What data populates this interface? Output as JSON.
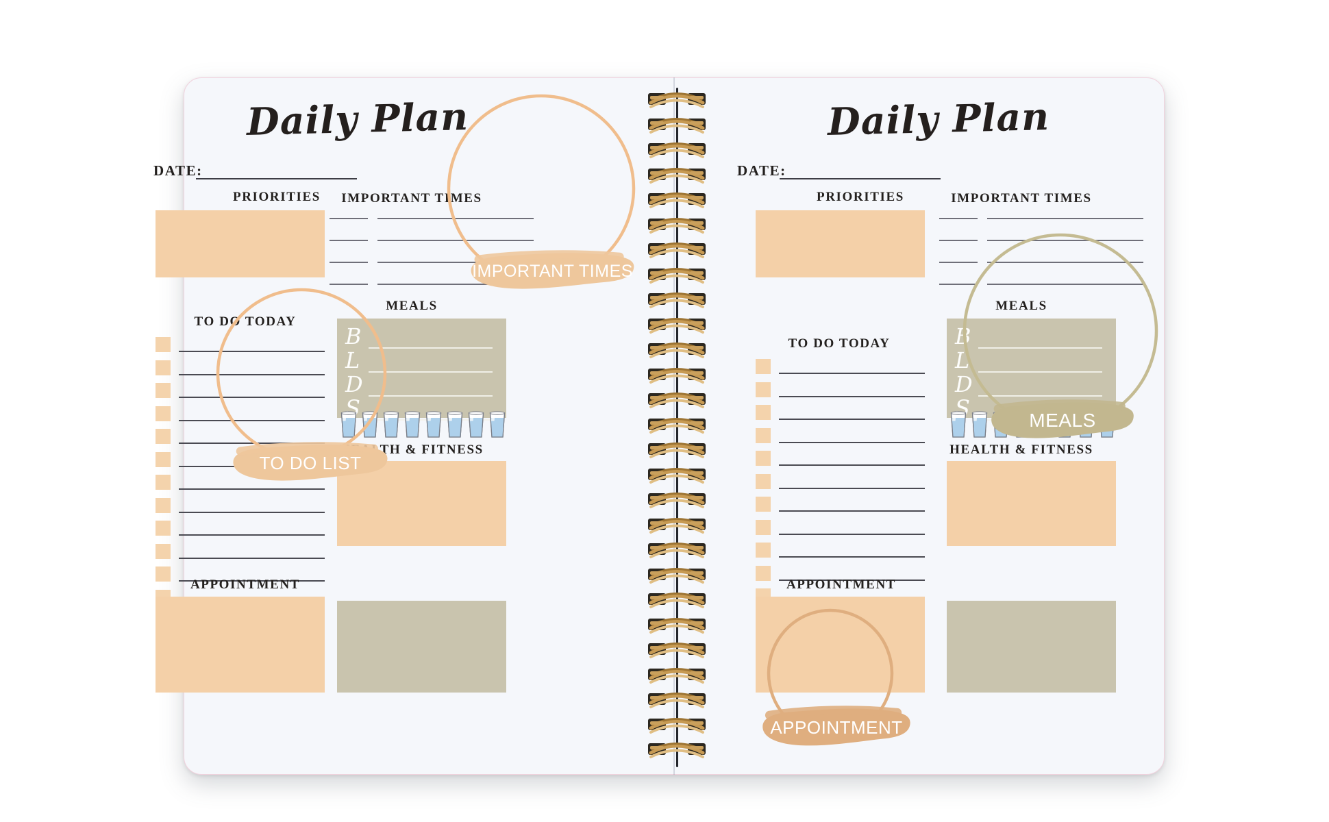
{
  "document": {
    "kind": "daily-planner-spread",
    "background": "#ffffff",
    "page_background": "#f5f7fb"
  },
  "colors": {
    "peach": "#f4d0a8",
    "khaki": "#c9c4ae",
    "peach_circle": "#f0bd8c",
    "khaki_circle": "#c4bb92",
    "badge_peach": "#eec79c",
    "badge_peach_dark": "#dfae7f",
    "badge_khaki": "#c2b78f",
    "rule": "#4a4a52",
    "ink": "#23201e",
    "water_fill": "#a9cdea",
    "spiral_gold": "#c79a53",
    "spiral_dark": "#2b2720"
  },
  "left_page": {
    "title": "Daily Plan",
    "date_label": "DATE:",
    "date_value": "",
    "sections": {
      "priorities": "PRIORITIES",
      "important_times": "IMPORTANT TIMES",
      "to_do_today": "TO DO TODAY",
      "meals": "MEALS",
      "health_fitness": "HEALTH & FITNESS",
      "appointment": "APPOINTMENT"
    },
    "meals_letters": [
      "B",
      "L",
      "D",
      "S"
    ],
    "to_do_checkbox_count": 12,
    "to_do_line_count": 12,
    "important_times_row_count": 4,
    "water_glass_count": 8
  },
  "right_page": {
    "title": "Daily Plan",
    "date_label": "DATE:",
    "date_value": "",
    "sections": {
      "priorities": "PRIORITIES",
      "important_times": "IMPORTANT TIMES",
      "to_do_today": "TO DO TODAY",
      "meals": "MEALS",
      "health_fitness": "HEALTH & FITNESS",
      "appointment": "APPOINTMENT"
    },
    "meals_letters": [
      "B",
      "L",
      "D",
      "S"
    ],
    "to_do_checkbox_count": 12,
    "to_do_line_count": 12,
    "important_times_row_count": 4,
    "water_glass_count": 8
  },
  "annotations": [
    {
      "id": "a1",
      "label": "IMPORTANT TIMES",
      "page": "left",
      "shape": "circle-and-badge",
      "color": "#eec79c"
    },
    {
      "id": "a2",
      "label": "TO DO LIST",
      "page": "left",
      "shape": "circle-and-badge",
      "color": "#eec79c"
    },
    {
      "id": "a3",
      "label": "MEALS",
      "page": "right",
      "shape": "circle-and-badge",
      "color": "#c2b78f"
    },
    {
      "id": "a4",
      "label": "APPOINTMENT",
      "page": "right",
      "shape": "circle-and-badge",
      "color": "#dfae7f"
    }
  ]
}
